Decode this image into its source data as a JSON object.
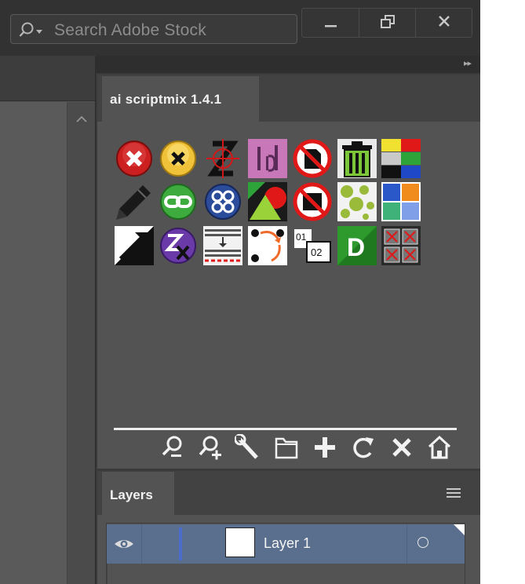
{
  "search": {
    "placeholder": "Search Adobe Stock",
    "icon": "search-dropdown-icon"
  },
  "window_controls": [
    "minimize-icon",
    "restore-icon",
    "close-icon"
  ],
  "dock": {
    "collapse_icon": "double-chevron-right-icon"
  },
  "scriptmix_panel": {
    "tab_label": "ai scriptmix 1.4.1",
    "script_icons": [
      [
        "red-x-circle-icon",
        "yellow-x-circle-icon",
        "z-crosshair-icon",
        "indesign-id-icon",
        "no-document-icon",
        "trash-bin-icon",
        "color-swatches-icon"
      ],
      [
        "pencil-icon",
        "link-chain-icon",
        "group-circles-icon",
        "shapes-triangle-circle-icon",
        "no-rectangle-icon",
        "scatter-dots-icon",
        "blue-orange-swatches-icon"
      ],
      [
        "scale-arrow-icon",
        "purple-z-x-icon",
        "text-align-icon",
        "rotate-arrows-icon",
        "numbering-icon",
        "green-d-icon",
        "red-x-grid-icon"
      ]
    ],
    "numbering_labels": [
      "01",
      "02"
    ],
    "d_label": "D",
    "toolbar": [
      "zoom-out-icon",
      "add-user-icon",
      "wrench-icon",
      "folder-icon",
      "plus-icon",
      "refresh-icon",
      "close-icon",
      "home-icon"
    ]
  },
  "layers_panel": {
    "tab_label": "Layers",
    "menu_icon": "panel-menu-icon",
    "layers": [
      {
        "name": "Layer 1",
        "visible": true,
        "color": "#4e6cc9"
      }
    ]
  }
}
